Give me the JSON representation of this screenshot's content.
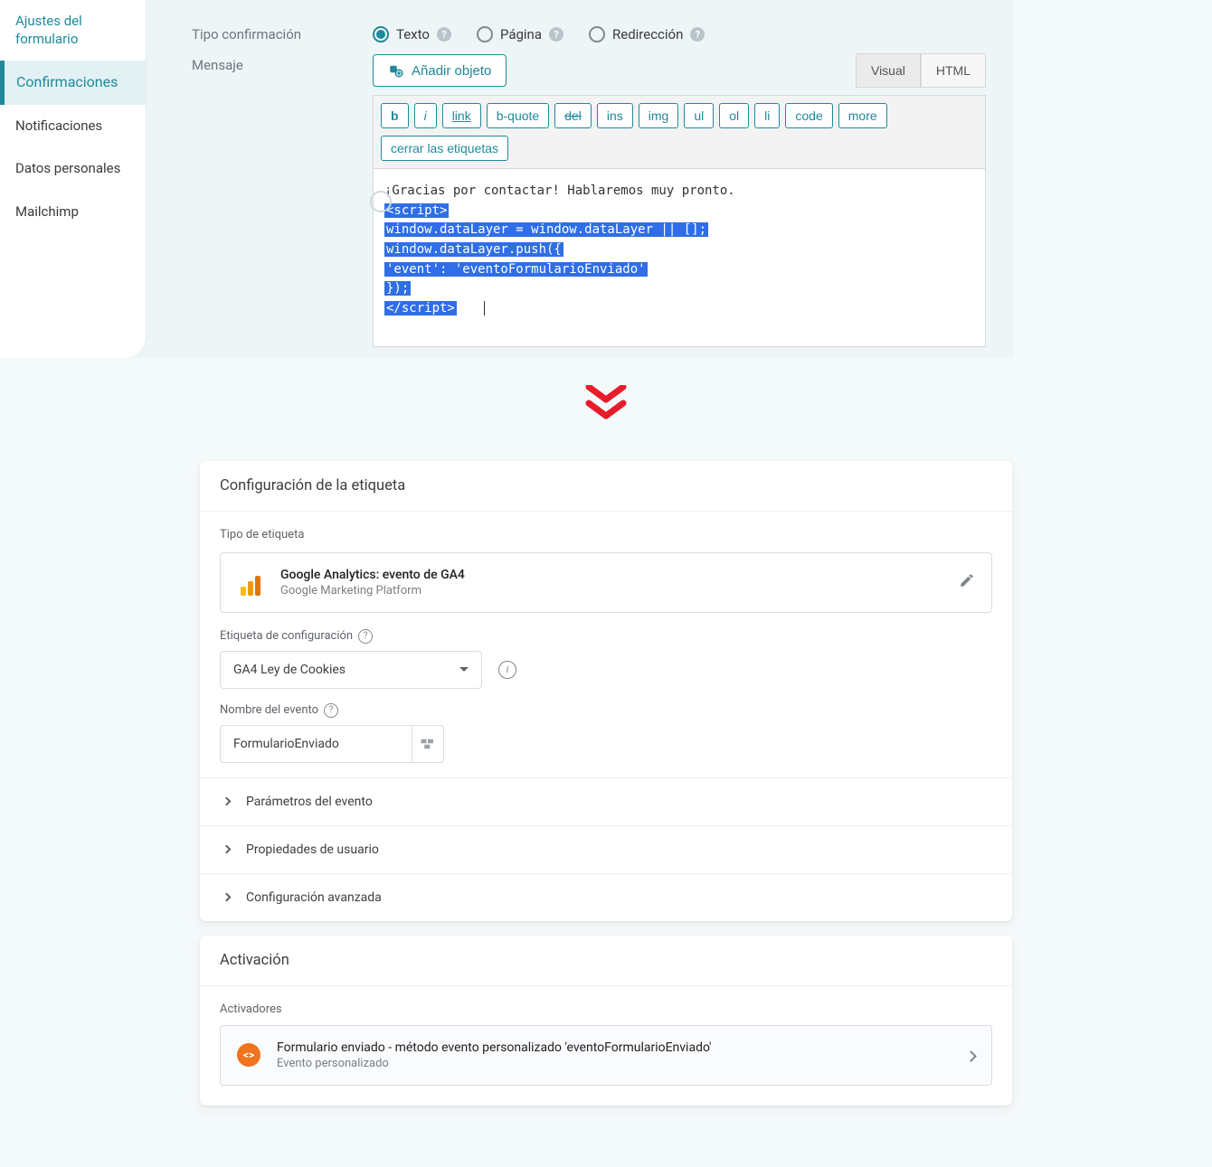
{
  "wp": {
    "sidebar": [
      {
        "label": "Ajustes del formulario"
      },
      {
        "label": "Confirmaciones"
      },
      {
        "label": "Notificaciones"
      },
      {
        "label": "Datos personales"
      },
      {
        "label": "Mailchimp"
      }
    ],
    "confirmation_type_label": "Tipo confirmación",
    "message_label": "Mensaje",
    "radios": {
      "text": "Texto",
      "page": "Página",
      "redirect": "Redirección"
    },
    "add_object": "Añadir objeto",
    "tabs": {
      "visual": "Visual",
      "html": "HTML"
    },
    "toolbar": {
      "b": "b",
      "i": "i",
      "link": "link",
      "bquote": "b-quote",
      "del": "del",
      "ins": "ins",
      "img": "img",
      "ul": "ul",
      "ol": "ol",
      "li": "li",
      "code": "code",
      "more": "more",
      "close": "cerrar las etiquetas"
    },
    "code": {
      "line1": "¡Gracias por contactar! Hablaremos muy pronto.",
      "line2": "<script>",
      "line3": "window.dataLayer = window.dataLayer || [];",
      "line4": "window.dataLayer.push({",
      "line5": " 'event': 'eventoFormularioEnviado'",
      "line6": "});",
      "line7": "</script>"
    }
  },
  "gtm": {
    "config_header": "Configuración de la etiqueta",
    "tag_type_label": "Tipo de etiqueta",
    "tag_type": {
      "title": "Google Analytics: evento de GA4",
      "subtitle": "Google Marketing Platform"
    },
    "config_tag_label": "Etiqueta de configuración",
    "config_tag_value": "GA4 Ley de Cookies",
    "event_name_label": "Nombre del evento",
    "event_name_value": "FormularioEnviado",
    "expanders": {
      "params": "Parámetros del evento",
      "user_props": "Propiedades de usuario",
      "advanced": "Configuración avanzada"
    },
    "activation_header": "Activación",
    "triggers_label": "Activadores",
    "trigger": {
      "title": "Formulario enviado - método evento personalizado 'eventoFormularioEnviado'",
      "subtitle": "Evento personalizado"
    }
  }
}
